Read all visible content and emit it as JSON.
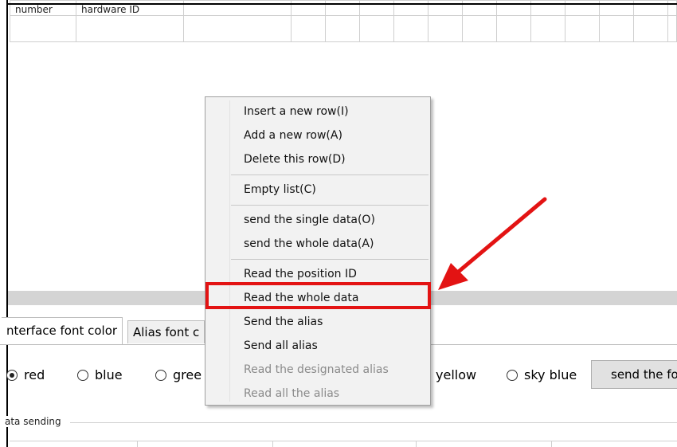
{
  "table": {
    "headers": [
      "number",
      "hardware ID",
      "",
      "",
      "",
      "",
      "",
      "",
      "",
      "",
      "",
      "",
      "",
      "",
      "",
      "",
      "",
      ""
    ]
  },
  "context_menu": {
    "items": [
      {
        "label": "Insert a new row(I)",
        "enabled": true
      },
      {
        "label": "Add a new row(A)",
        "enabled": true
      },
      {
        "label": "Delete this row(D)",
        "enabled": true
      },
      {
        "label": "Empty list(C)",
        "enabled": true
      },
      {
        "label": "send the single data(O)",
        "enabled": true
      },
      {
        "label": "send the whole data(A)",
        "enabled": true
      },
      {
        "label": "Read the position ID",
        "enabled": true
      },
      {
        "label": "Read the whole data",
        "enabled": true,
        "highlighted": true
      },
      {
        "label": "Send the alias",
        "enabled": true
      },
      {
        "label": "Send all alias",
        "enabled": true
      },
      {
        "label": "Read the designated alias",
        "enabled": false
      },
      {
        "label": "Read all the alias",
        "enabled": false
      }
    ]
  },
  "tabs": [
    {
      "label": "nterface font color",
      "active": true
    },
    {
      "label": "Alias font c",
      "active": false
    }
  ],
  "colors": {
    "options": [
      {
        "label": "red",
        "checked": true
      },
      {
        "label": "blue",
        "checked": false
      },
      {
        "label": "gree",
        "checked": false
      },
      {
        "label": "yellow",
        "checked": false
      },
      {
        "label": "sky blue",
        "checked": false
      }
    ],
    "send_button": "send the fo"
  },
  "data_sending": {
    "label": "ata sending"
  },
  "annotation": {
    "highlight_color": "#e31313"
  }
}
